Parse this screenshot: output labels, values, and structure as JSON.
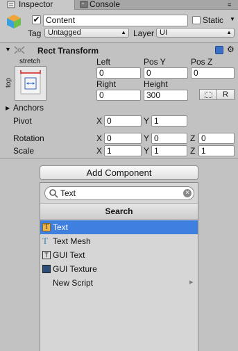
{
  "tabs": {
    "inspector": "Inspector",
    "console": "Console"
  },
  "gameobject": {
    "active": true,
    "name": "Content",
    "static_label": "Static",
    "static_checked": false,
    "tag_label": "Tag",
    "tag_value": "Untagged",
    "layer_label": "Layer",
    "layer_value": "UI"
  },
  "rect_transform": {
    "title": "Rect Transform",
    "anchor_preset_h": "stretch",
    "anchor_preset_v": "top",
    "fields_row1": {
      "left_label": "Left",
      "left_value": "0",
      "posy_label": "Pos Y",
      "posy_value": "0",
      "posz_label": "Pos Z",
      "posz_value": "0"
    },
    "fields_row2": {
      "right_label": "Right",
      "right_value": "0",
      "height_label": "Height",
      "height_value": "300"
    },
    "r_button": "R",
    "anchors_label": "Anchors",
    "pivot": {
      "label": "Pivot",
      "x_label": "X",
      "x": "0",
      "y_label": "Y",
      "y": "1"
    },
    "rotation": {
      "label": "Rotation",
      "x_label": "X",
      "x": "0",
      "y_label": "Y",
      "y": "0",
      "z_label": "Z",
      "z": "0"
    },
    "scale": {
      "label": "Scale",
      "x_label": "X",
      "x": "1",
      "y_label": "Y",
      "y": "1",
      "z_label": "Z",
      "z": "1"
    }
  },
  "add_component": {
    "button_label": "Add Component",
    "search_value": "Text",
    "search_header": "Search",
    "results": [
      {
        "label": "Text",
        "icon": "text-icon",
        "selected": true
      },
      {
        "label": "Text Mesh",
        "icon": "text-mesh-icon",
        "selected": false
      },
      {
        "label": "GUI Text",
        "icon": "gui-text-icon",
        "selected": false
      },
      {
        "label": "GUI Texture",
        "icon": "gui-texture-icon",
        "selected": false
      },
      {
        "label": "New Script",
        "icon": "",
        "selected": false,
        "has_submenu": true
      }
    ]
  },
  "colors": {
    "selection": "#3f7fe0",
    "panel": "#c2c2c2",
    "anchor_red": "#d02020",
    "anchor_blue": "#3060c0"
  }
}
